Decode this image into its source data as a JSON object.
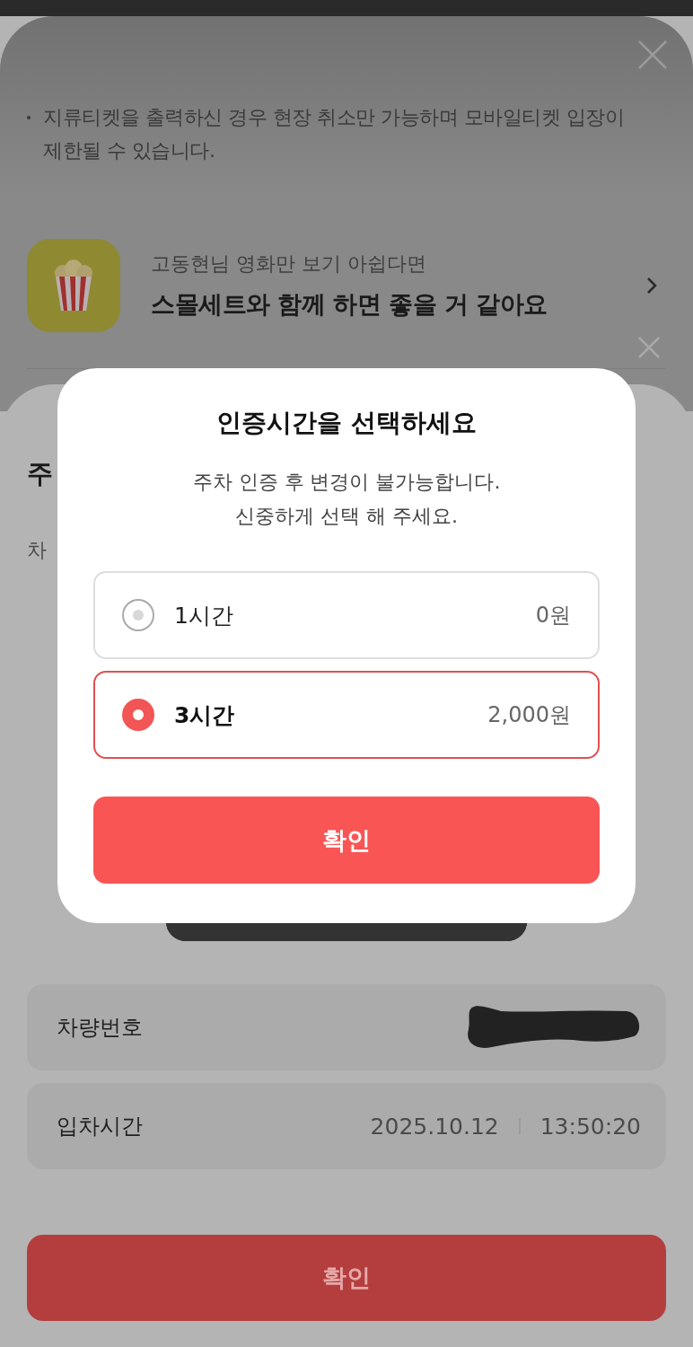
{
  "background_sheet": {
    "notice": "지류티켓을 출력하신 경우 현장 취소만 가능하며 모바일티켓 입장이 제한될 수 있습니다.",
    "promo": {
      "subtitle": "고동현님 영화만 보기 아쉽다면",
      "title": "스몰세트와 함께 하면 좋을 거 같아요"
    }
  },
  "parking_sheet": {
    "title": "주",
    "label": "차",
    "fields": [
      {
        "kind": "redacted",
        "label": "차량번호"
      },
      {
        "kind": "datetime",
        "label": "입차시간",
        "date": "2025.10.12",
        "time": "13:50:20"
      }
    ],
    "button": "확인"
  },
  "dialog": {
    "title": "인증시간을 선택하세요",
    "message_lines": [
      "주차 인증 후 변경이 불가능합니다.",
      "신중하게 선택 해 주세요."
    ],
    "options": [
      {
        "label": "1시간",
        "price": "0원",
        "selected": false
      },
      {
        "label": "3시간",
        "price": "2,000원",
        "selected": true
      }
    ],
    "confirm": "확인"
  }
}
